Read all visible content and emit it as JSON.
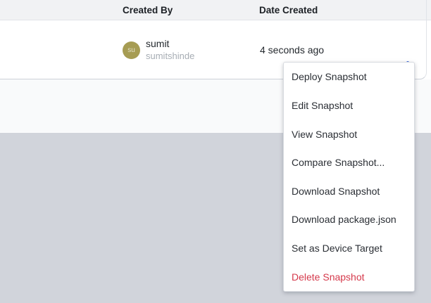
{
  "table": {
    "columns": [
      {
        "label": "Created By"
      },
      {
        "label": "Date Created"
      }
    ],
    "row": {
      "user": {
        "initials": "su",
        "name": "sumit",
        "username": "sumitshinde"
      },
      "date_created": "4 seconds ago",
      "actions_icon": "kebab-menu-icon"
    }
  },
  "menu": {
    "items": [
      {
        "label": "Deploy Snapshot",
        "danger": false
      },
      {
        "label": "Edit Snapshot",
        "danger": false
      },
      {
        "label": "View Snapshot",
        "danger": false
      },
      {
        "label": "Compare Snapshot...",
        "danger": false
      },
      {
        "label": "Download Snapshot",
        "danger": false
      },
      {
        "label": "Download package.json",
        "danger": false
      },
      {
        "label": "Set as Device Target",
        "danger": false
      },
      {
        "label": "Delete Snapshot",
        "danger": true
      }
    ]
  },
  "colors": {
    "accent_blue": "#3562d9",
    "danger_red": "#d5394b",
    "avatar_olive": "#a69c53",
    "header_bg": "#f1f2f4",
    "page_bg_light": "#f9fafb",
    "page_bg_dark": "#d1d4db"
  }
}
